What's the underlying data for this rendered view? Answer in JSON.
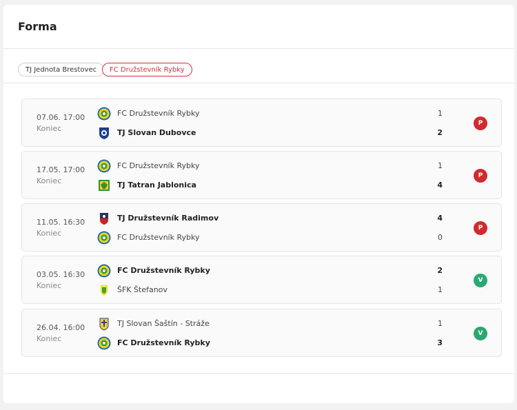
{
  "widget": {
    "title": "Forma"
  },
  "tabs": [
    {
      "label": "TJ Jednota Brestovec",
      "active": false
    },
    {
      "label": "FC Družstevník Rybky",
      "active": true
    }
  ],
  "colors": {
    "accent": "#d0323a",
    "loss": "#d12a2f",
    "win": "#2ba872"
  },
  "matches": [
    {
      "date": "07.06. 17:00",
      "status": "Koniec",
      "home": {
        "name": "FC Družstevník Rybky",
        "score": "1",
        "crest": "rybky-crest-icon",
        "winner": false
      },
      "away": {
        "name": "TJ Slovan Dubovce",
        "score": "2",
        "crest": "dubovce-crest-icon",
        "winner": true
      },
      "result": "P"
    },
    {
      "date": "17.05. 17:00",
      "status": "Koniec",
      "home": {
        "name": "FC Družstevník Rybky",
        "score": "1",
        "crest": "rybky-crest-icon",
        "winner": false
      },
      "away": {
        "name": "TJ Tatran Jablonica",
        "score": "4",
        "crest": "jablonica-crest-icon",
        "winner": true
      },
      "result": "P"
    },
    {
      "date": "11.05. 16:30",
      "status": "Koniec",
      "home": {
        "name": "TJ Družstevník Radimov",
        "score": "4",
        "crest": "radimov-crest-icon",
        "winner": true
      },
      "away": {
        "name": "FC Družstevník Rybky",
        "score": "0",
        "crest": "rybky-crest-icon",
        "winner": false
      },
      "result": "P"
    },
    {
      "date": "03.05. 16:30",
      "status": "Koniec",
      "home": {
        "name": "FC Družstevník Rybky",
        "score": "2",
        "crest": "rybky-crest-icon",
        "winner": true
      },
      "away": {
        "name": "ŠFK Štefanov",
        "score": "1",
        "crest": "stefanov-crest-icon",
        "winner": false
      },
      "result": "V"
    },
    {
      "date": "26.04. 16:00",
      "status": "Koniec",
      "home": {
        "name": "TJ Slovan Šaštín - Stráže",
        "score": "1",
        "crest": "sastin-crest-icon",
        "winner": false
      },
      "away": {
        "name": "FC Družstevník Rybky",
        "score": "3",
        "crest": "rybky-crest-icon",
        "winner": true
      },
      "result": "V"
    }
  ]
}
